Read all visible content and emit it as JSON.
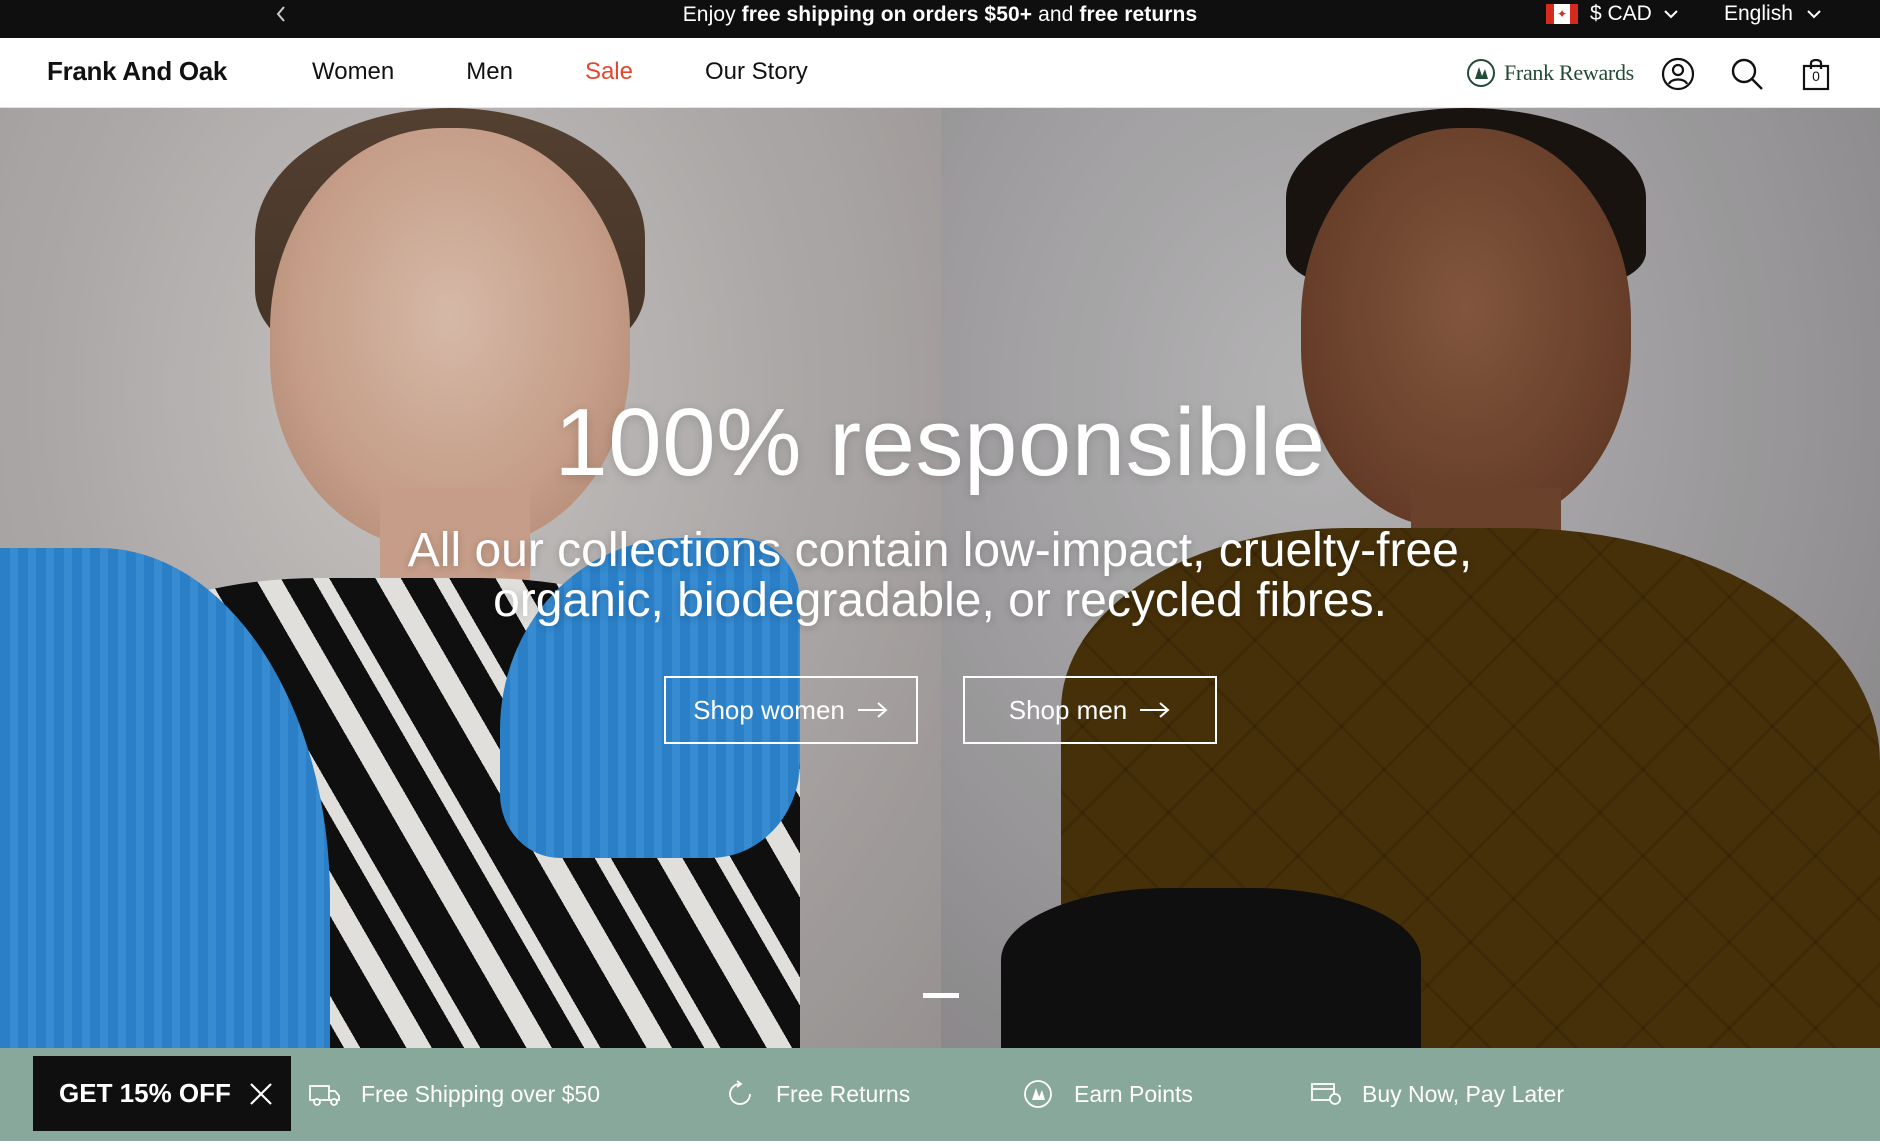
{
  "announcement": {
    "prefix": "Enjoy ",
    "bold1": "free shipping on orders $50+",
    "middle": " and ",
    "bold2": "free returns",
    "currency": "$ CAD",
    "language": "English"
  },
  "header": {
    "logo": "Frank And Oak",
    "nav": [
      "Women",
      "Men",
      "Sale",
      "Our Story"
    ],
    "rewards": "Frank Rewards",
    "cart_count": "0",
    "colors": {
      "sale": "#e4472a",
      "rewards": "#234a37"
    }
  },
  "hero": {
    "title": "100% responsible",
    "subtitle_line1": "All our collections contain low-impact, cruelty-free,",
    "subtitle_line2": "organic, biodegradable, or recycled fibres.",
    "buttons": {
      "women": "Shop women",
      "men": "Shop men"
    }
  },
  "perks": {
    "offer": "GET 15% OFF",
    "items": [
      "Free Shipping over $50",
      "Free Returns",
      "Earn Points",
      "Buy Now, Pay Later"
    ],
    "background": "#89a89c"
  }
}
